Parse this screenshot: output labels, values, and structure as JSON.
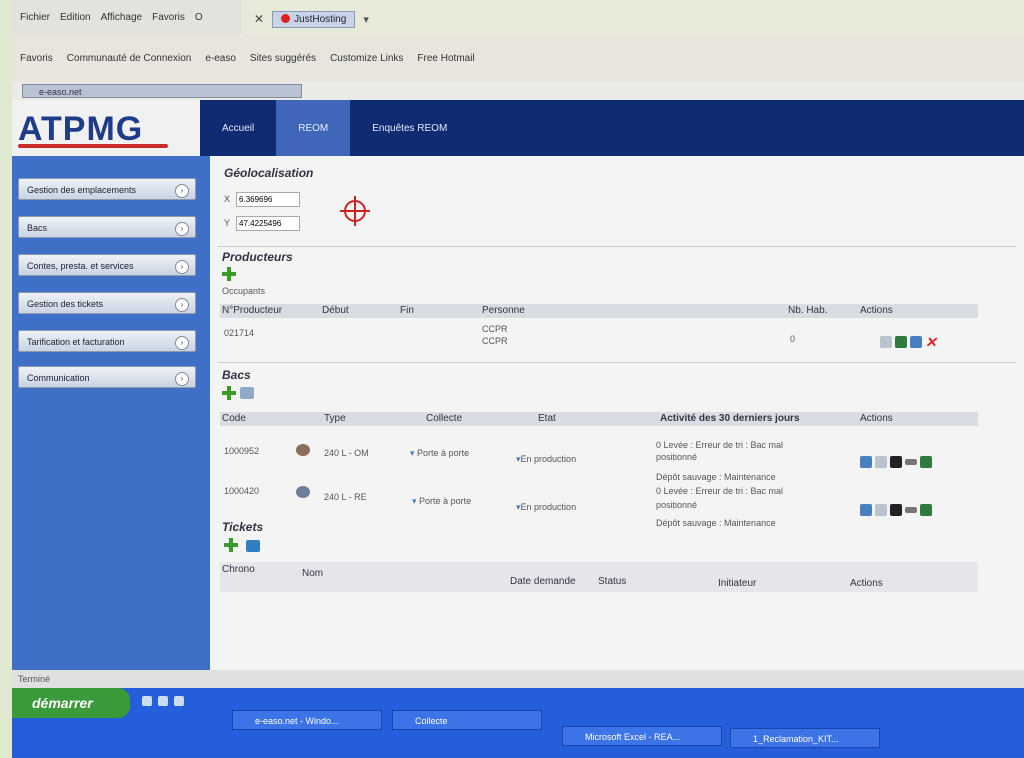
{
  "browser": {
    "menu": [
      "Fichier",
      "Edition",
      "Affichage",
      "Favoris",
      "O"
    ],
    "tab_label": "JustHosting",
    "favorites": [
      "Favoris",
      "Communauté de Connexion",
      "e-easo",
      "Sites suggérés",
      "Customize Links",
      "Free Hotmail"
    ],
    "address": "e-easo.net"
  },
  "app": {
    "logo": "ATPMG",
    "nav": [
      {
        "label": "Accueil"
      },
      {
        "label": "REOM"
      },
      {
        "label": "Enquêtes REOM"
      }
    ],
    "sidebar": [
      {
        "label": "Gestion des emplacements"
      },
      {
        "label": "Bacs"
      },
      {
        "label": "Contes, presta. et services"
      },
      {
        "label": "Gestion des tickets"
      },
      {
        "label": "Tarification et facturation"
      },
      {
        "label": "Communication"
      }
    ]
  },
  "geo": {
    "title": "Géolocalisation",
    "x_label": "X",
    "x_value": "6.369696",
    "y_label": "Y",
    "y_value": "47.4225496"
  },
  "producteurs": {
    "title": "Producteurs",
    "occupants": "Occupants",
    "headers": [
      "N°Producteur",
      "Début",
      "Fin",
      "Personne",
      "Nb. Hab.",
      "Actions"
    ],
    "row": {
      "num": "021714",
      "personne_1": "CCPR",
      "personne_2": "CCPR",
      "nb_hab": "0"
    }
  },
  "bacs": {
    "title": "Bacs",
    "headers": [
      "Code",
      "Type",
      "Collecte",
      "Etat",
      "Activité des 30 derniers jours",
      "Actions"
    ],
    "rows": [
      {
        "code": "1000952",
        "type": "240 L - OM",
        "collecte": "Porte à porte",
        "etat": "En production",
        "act_1": "0 Levée : Erreur de tri : Bac mal",
        "act_2": "positionné",
        "act_3": "Dépôt sauvage : Maintenance"
      },
      {
        "code": "1000420",
        "type": "240 L - RE",
        "collecte": "Porte à porte",
        "etat": "En production",
        "act_1": "0 Levée : Erreur de tri : Bac mal",
        "act_2": "positionné",
        "act_3": "Dépôt sauvage : Maintenance"
      }
    ]
  },
  "tickets": {
    "title": "Tickets",
    "headers": [
      "Chrono",
      "Nom",
      "Date demande",
      "Status",
      "Initiateur",
      "Actions"
    ]
  },
  "statusbar": "Terminé",
  "taskbar": {
    "start": "démarrer",
    "tasks": [
      "e-easo.net - Windo...",
      "Collecte",
      "Microsoft Excel - REA...",
      "1_Reclamation_KIT..."
    ]
  }
}
